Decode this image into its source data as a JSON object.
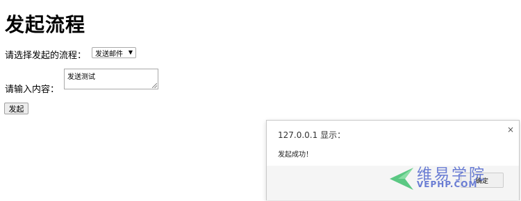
{
  "page": {
    "title": "发起流程",
    "process_label": "请选择发起的流程：",
    "process_selected": "发送邮件",
    "content_label": "请输入内容：",
    "content_value": "发送测试",
    "submit_label": "发起"
  },
  "dialog": {
    "title": "127.0.0.1 显示：",
    "close_glyph": "×",
    "message": "发起成功！",
    "ok_label": "确定"
  },
  "watermark": {
    "text_cn": "维易学院",
    "text_en": "VEPHP.COM"
  },
  "icons": {
    "select_arrow": "▼"
  },
  "colors": {
    "watermark_blue": "#5a6fd0",
    "watermark_green": "#3fbf6f"
  }
}
